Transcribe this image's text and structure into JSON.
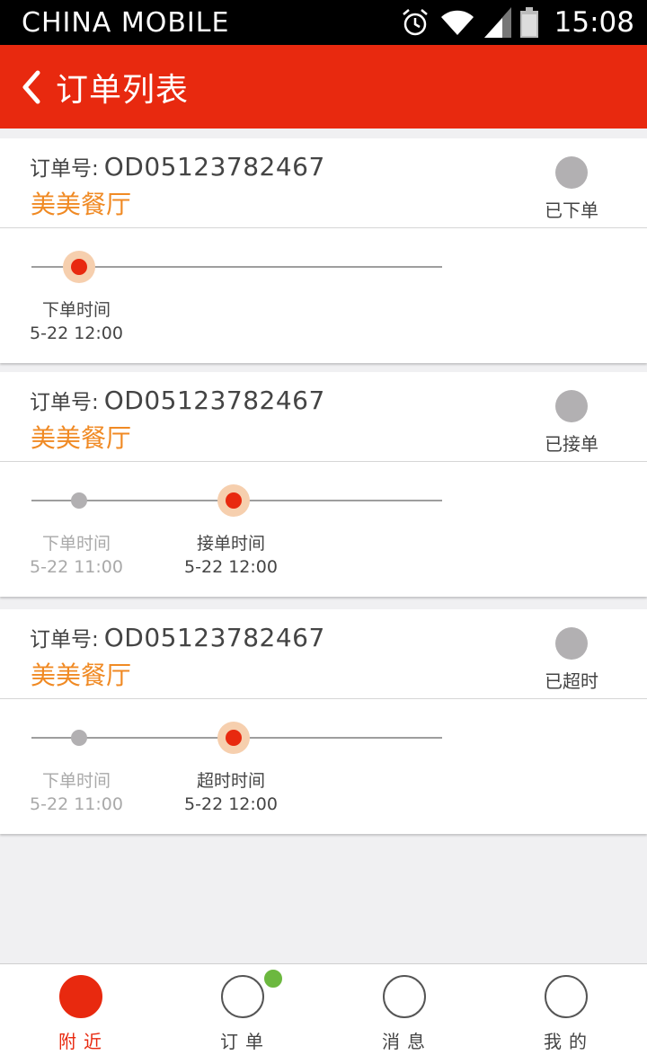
{
  "status_bar": {
    "carrier": "CHINA  MOBILE",
    "time": "15:08",
    "icons": [
      "alarm-icon",
      "wifi-icon",
      "signal-icon",
      "battery-icon"
    ]
  },
  "app_bar": {
    "back_icon": "chevron-left-icon",
    "title": "订单列表"
  },
  "orders": [
    {
      "order_label": "订单号:",
      "order_no": "OD05123782467",
      "restaurant": "美美餐厅",
      "status": "已下单",
      "steps": [
        {
          "label": "下单时间",
          "time": "5-22 12:00",
          "state": "current"
        }
      ]
    },
    {
      "order_label": "订单号:",
      "order_no": "OD05123782467",
      "restaurant": "美美餐厅",
      "status": "已接单",
      "steps": [
        {
          "label": "下单时间",
          "time": "5-22 11:00",
          "state": "done"
        },
        {
          "label": "接单时间",
          "time": "5-22 12:00",
          "state": "current"
        }
      ]
    },
    {
      "order_label": "订单号:",
      "order_no": "OD05123782467",
      "restaurant": "美美餐厅",
      "status": "已超时",
      "steps": [
        {
          "label": "下单时间",
          "time": "5-22 11:00",
          "state": "done"
        },
        {
          "label": "超时时间",
          "time": "5-22 12:00",
          "state": "current"
        }
      ]
    }
  ],
  "bottom_nav": {
    "items": [
      {
        "label": "附近",
        "active": true,
        "badge": false
      },
      {
        "label": "订单",
        "active": false,
        "badge": true
      },
      {
        "label": "消息",
        "active": false,
        "badge": false
      },
      {
        "label": "我的",
        "active": false,
        "badge": false
      }
    ]
  },
  "colors": {
    "brand_red": "#e8290f",
    "restaurant_orange": "#f08a24",
    "badge_green": "#6cb83f",
    "status_gray": "#b2b0b2"
  }
}
